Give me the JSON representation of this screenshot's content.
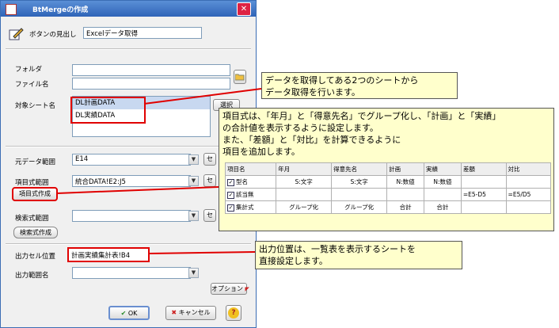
{
  "dialog": {
    "title": "BtMergeの作成",
    "close_glyph": "✕",
    "button_caption_label": "ボタンの見出し",
    "button_caption_value": "Excelデータ取得",
    "folder_label": "フォルダ",
    "filename_label": "ファイル名",
    "sheets_label": "対象シート名",
    "sheets": [
      "DL計画DATA",
      "DL実績DATA"
    ],
    "select_button": "選択",
    "source_range_label": "元データ範囲",
    "source_range_value": "E14",
    "item_range_label": "項目式範囲",
    "item_range_value": "統合DATA!E2:J5",
    "item_create_button": "項目式作成",
    "search_range_label": "検索式範囲",
    "search_create_button": "検索式作成",
    "output_cell_label": "出力セル位置",
    "output_cell_value": "計画実績集計表!B4",
    "output_range_label": "出力範囲名",
    "options_button": "オプション",
    "ok_button": "OK",
    "cancel_button": "キャンセル",
    "help_button": "?",
    "set_button": "セ"
  },
  "callout1": {
    "line1": "データを取得してある2つのシートから",
    "line2": "データ取得を行います。"
  },
  "callout2": {
    "line1": "項目式は、「年月」と「得意先名」でグループ化し、「計画」と「実績」",
    "line2": "の合計値を表示するように設定します。",
    "line3": "また、「差額」と「対比」を計算できるように",
    "line4": "項目を追加します。"
  },
  "grid": {
    "headers": [
      "項目名",
      "年月",
      "得意先名",
      "計画",
      "実績",
      "差額",
      "対比"
    ],
    "rows": [
      [
        "型名",
        "S:文字",
        "S:文字",
        "N:数値",
        "N:数値",
        "",
        ""
      ],
      [
        "該当無",
        "",
        "",
        "",
        "",
        "=E5-D5",
        "=E5/D5"
      ],
      [
        "集計式",
        "グループ化",
        "グループ化",
        "合計",
        "合計",
        "",
        ""
      ]
    ]
  },
  "callout3": {
    "line1": "出力位置は、一覧表を表示するシートを",
    "line2": "直接設定します。"
  },
  "colors": {
    "accent": "#2f64b8",
    "highlight": "#e00000",
    "note_bg": "#ffffcc"
  }
}
